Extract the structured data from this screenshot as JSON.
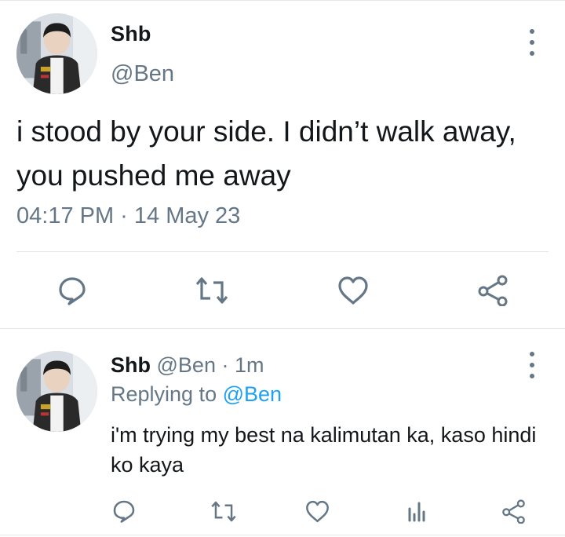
{
  "main_tweet": {
    "display_name": "Shb",
    "handle": "@Ben",
    "text": "i stood by your side. I didn’t walk away, you pushed me away",
    "timestamp": "04:17 PM · 14 May 23",
    "actions": [
      "reply-icon",
      "retweet-icon",
      "like-icon",
      "share-icon"
    ]
  },
  "reply": {
    "display_name": "Shb",
    "handle": "@Ben",
    "separator": " · ",
    "time_ago": "1m",
    "replying_prefix": "Replying to ",
    "replying_to": "@Ben",
    "text": "i'm trying my best na kalimutan ka, kaso hindi ko kaya",
    "actions": [
      "reply-icon",
      "retweet-icon",
      "like-icon",
      "analytics-icon",
      "share-icon"
    ]
  },
  "colors": {
    "text": "#14171a",
    "secondary": "#657786",
    "link": "#1da1f2",
    "divider": "#e1e8ed"
  }
}
